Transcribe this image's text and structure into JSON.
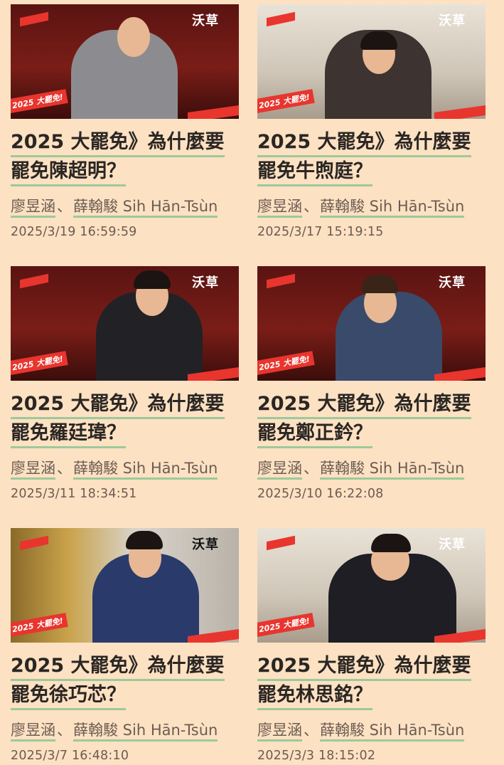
{
  "brand_label": "沃草",
  "stamp_label": "2025 大罷免!",
  "articles": [
    {
      "title_line1": "2025 大罷免》為什麼要",
      "title_line2": "罷免陳超明？",
      "author1": "廖昱涵",
      "separator": "、",
      "author2": "薛翰駿 Sih Hān-Tsùn",
      "date": "2025/3/19 16:59:59"
    },
    {
      "title_line1": "2025 大罷免》為什麼要",
      "title_line2": "罷免牛煦庭？",
      "author1": "廖昱涵",
      "separator": "、",
      "author2": "薛翰駿 Sih Hān-Tsùn",
      "date": "2025/3/17 15:19:15"
    },
    {
      "title_line1": "2025 大罷免》為什麼要",
      "title_line2": "罷免羅廷瑋？",
      "author1": "廖昱涵",
      "separator": "、",
      "author2": "薛翰駿 Sih Hān-Tsùn",
      "date": "2025/3/11 18:34:51"
    },
    {
      "title_line1": "2025 大罷免》為什麼要",
      "title_line2": "罷免鄭正鈐？",
      "author1": "廖昱涵",
      "separator": "、",
      "author2": "薛翰駿 Sih Hān-Tsùn",
      "date": "2025/3/10 16:22:08"
    },
    {
      "title_line1": "2025 大罷免》為什麼要",
      "title_line2": "罷免徐巧芯？",
      "author1": "廖昱涵",
      "separator": "、",
      "author2": "薛翰駿 Sih Hān-Tsùn",
      "date": "2025/3/7 16:48:10"
    },
    {
      "title_line1": "2025 大罷免》為什麼要",
      "title_line2": "罷免林思銘？",
      "author1": "廖昱涵",
      "separator": "、",
      "author2": "薛翰駿 Sih Hān-Tsùn",
      "date": "2025/3/3 18:15:02"
    }
  ],
  "colors": {
    "page_background": "#fde1c3",
    "accent_red": "#e8352e",
    "underline_green": "#9cc99a"
  }
}
